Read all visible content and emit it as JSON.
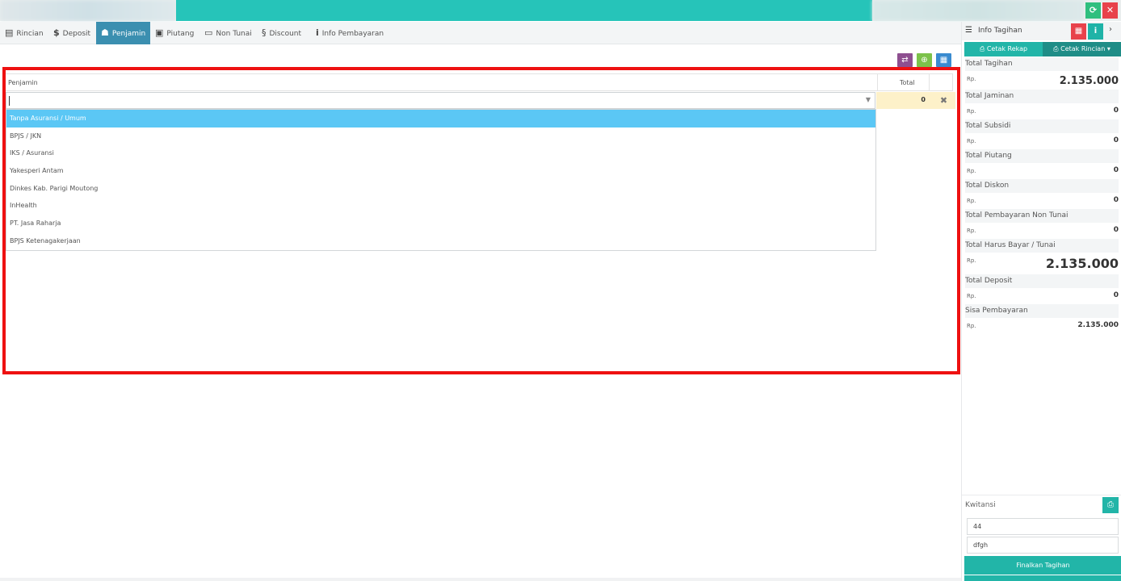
{
  "tabs": [
    {
      "label": "Rincian",
      "icon": "list-icon"
    },
    {
      "label": "Deposit",
      "icon": "dollar-icon"
    },
    {
      "label": "Penjamin",
      "icon": "user-icon"
    },
    {
      "label": "Piutang",
      "icon": "money-icon"
    },
    {
      "label": "Non Tunai",
      "icon": "card-icon"
    },
    {
      "label": "Discount",
      "icon": "discount-icon"
    },
    {
      "label": "Info Pembayaran",
      "icon": "info-icon"
    }
  ],
  "active_tab": "Penjamin",
  "table": {
    "headers": {
      "penjamin": "Penjamin",
      "total": "Total"
    },
    "row": {
      "penjamin_value": "",
      "total": "0"
    }
  },
  "dropdown_options": [
    "Tanpa Asuransi / Umum",
    "BPJS / JKN",
    "IKS / Asuransi",
    "Yakesperi Antam",
    "Dinkes Kab. Parigi Moutong",
    "InHealth",
    "PT. Jasa Raharja",
    "BPJS Ketenagakerjaan"
  ],
  "selected_option_index": 0,
  "info_panel": {
    "title": "Info Tagihan",
    "cetak_rekap": "Cetak Rekap",
    "cetak_rincian": "Cetak Rincian",
    "currency": "Rp.",
    "summary": [
      {
        "label": "Total Tagihan",
        "value": "2.135.000",
        "size": "big"
      },
      {
        "label": "Total Jaminan",
        "value": "0",
        "size": "small"
      },
      {
        "label": "Total Subsidi",
        "value": "0",
        "size": "small"
      },
      {
        "label": "Total Piutang",
        "value": "0",
        "size": "small"
      },
      {
        "label": "Total Diskon",
        "value": "0",
        "size": "small"
      },
      {
        "label": "Total Pembayaran Non Tunai",
        "value": "0",
        "size": "small"
      },
      {
        "label": "Total Harus Bayar / Tunai",
        "value": "2.135.000",
        "size": "huge"
      },
      {
        "label": "Total Deposit",
        "value": "0",
        "size": "small"
      },
      {
        "label": "Sisa Pembayaran",
        "value": "2.135.000",
        "size": "small"
      }
    ],
    "kwitansi": {
      "label": "Kwitansi",
      "field1": "44",
      "field2": "dfgh"
    },
    "finalize_label": "Finalkan Tagihan"
  },
  "colors": {
    "accent": "#22b5a8",
    "highlight": "#ee1111",
    "selected": "#5bc7f5",
    "active_tab": "#3b8fb0"
  }
}
